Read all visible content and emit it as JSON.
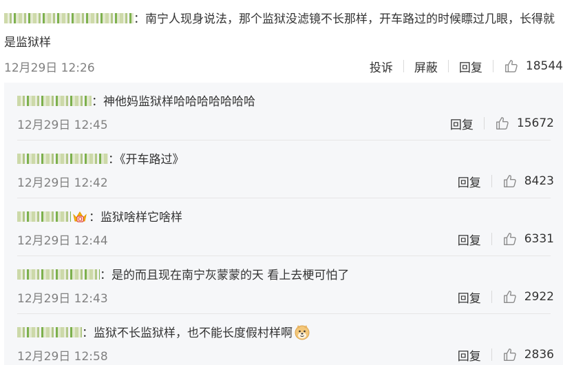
{
  "main_comment": {
    "text": "南宁人现身说法，那个监狱没滤镜不长那样，开车路过的时候瞟过几眼，长得就是监狱样",
    "time": "12月29日 12:26",
    "report_label": "投诉",
    "block_label": "屏蔽",
    "reply_label": "回复",
    "likes": "18544"
  },
  "replies": [
    {
      "text": "神他妈监狱样哈哈哈哈哈哈哈",
      "time": "12月29日 12:45",
      "reply_label": "回复",
      "likes": "15672"
    },
    {
      "text": "《开车路过》",
      "time": "12月29日 12:42",
      "reply_label": "回复",
      "likes": "8423"
    },
    {
      "text": "监狱啥样它啥样",
      "time": "12月29日 12:44",
      "reply_label": "回复",
      "likes": "6331"
    },
    {
      "text": "是的而且现在南宁灰蒙蒙的天 看上去梗可怕了",
      "time": "12月29日 12:43",
      "reply_label": "回复",
      "likes": "2922"
    },
    {
      "text": "监狱不长监狱样，也不能长度假村样啊",
      "time": "12月29日 12:58",
      "reply_label": "回复",
      "likes": "2836"
    }
  ],
  "colors": {
    "reply_background": "#f6f7f9",
    "meta_gray": "#808080",
    "text": "#333333"
  },
  "icons": {
    "like": "thumbs-up-icon",
    "crown_badge": "crown-emoji-icon",
    "doge": "doge-emoji-icon"
  }
}
